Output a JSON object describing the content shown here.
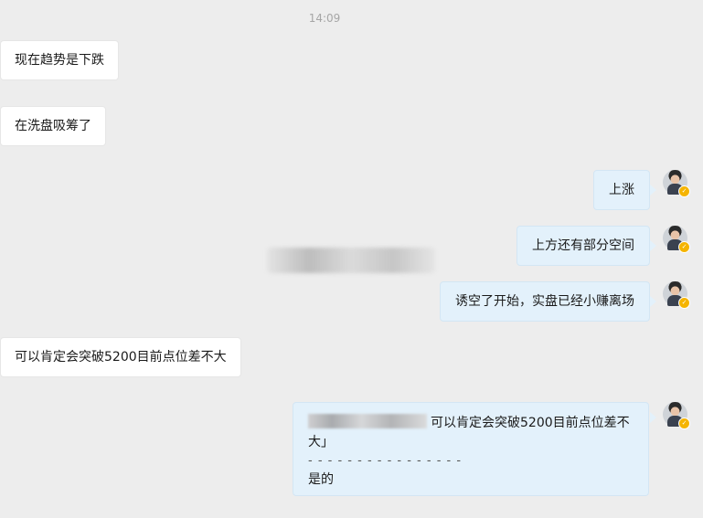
{
  "timestamp": "14:09",
  "messages": [
    {
      "side": "left",
      "text": "现在趋势是下跌"
    },
    {
      "side": "left",
      "text": "在洗盘吸筹了"
    },
    {
      "side": "right",
      "text": "上涨"
    },
    {
      "side": "right",
      "text": "上方还有部分空间"
    },
    {
      "side": "right",
      "text": "诱空了开始，实盘已经小赚离场"
    },
    {
      "side": "left",
      "text": "可以肯定会突破5200目前点位差不大"
    },
    {
      "side": "right",
      "quote_text": "可以肯定会突破5200目前点位差不大」",
      "divider": "- - - - - - - - - - - - - - - -",
      "text": "是的"
    }
  ],
  "colors": {
    "background": "#ededed",
    "left_bubble": "#ffffff",
    "right_bubble": "#e3f1fb",
    "badge": "#f5b400"
  },
  "icons": {
    "avatar": "user-avatar",
    "verified": "verified-badge-icon"
  }
}
